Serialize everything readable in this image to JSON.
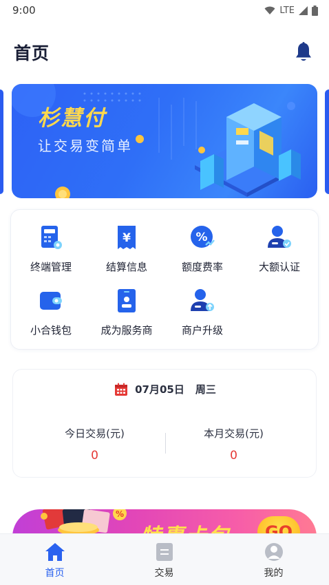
{
  "status_bar": {
    "time": "9:00",
    "network": "LTE"
  },
  "header": {
    "title": "首页",
    "bell_icon": "bell-icon"
  },
  "banner": {
    "title": "杉慧付",
    "subtitle": "让交易变简单"
  },
  "menu": {
    "items": [
      {
        "label": "终端管理",
        "icon": "terminal-icon"
      },
      {
        "label": "结算信息",
        "icon": "settlement-icon"
      },
      {
        "label": "额度费率",
        "icon": "rate-icon"
      },
      {
        "label": "大额认证",
        "icon": "verify-icon"
      },
      {
        "label": "小合钱包",
        "icon": "wallet-icon"
      },
      {
        "label": "成为服务商",
        "icon": "provider-icon"
      },
      {
        "label": "商户升级",
        "icon": "upgrade-icon"
      }
    ]
  },
  "stats": {
    "date": "07月05日",
    "weekday": "周三",
    "today_label": "今日交易(元)",
    "today_value": "0",
    "month_label": "本月交易(元)",
    "month_value": "0"
  },
  "promo": {
    "text": "特惠卡包",
    "go_label": "GO"
  },
  "bottom_nav": {
    "items": [
      {
        "label": "首页",
        "icon": "home-icon",
        "active": true
      },
      {
        "label": "交易",
        "icon": "transaction-icon",
        "active": false
      },
      {
        "label": "我的",
        "icon": "profile-icon",
        "active": false
      }
    ]
  },
  "colors": {
    "accent": "#2a62ef",
    "value_red": "#e53935",
    "banner_title": "#ffd94d"
  }
}
